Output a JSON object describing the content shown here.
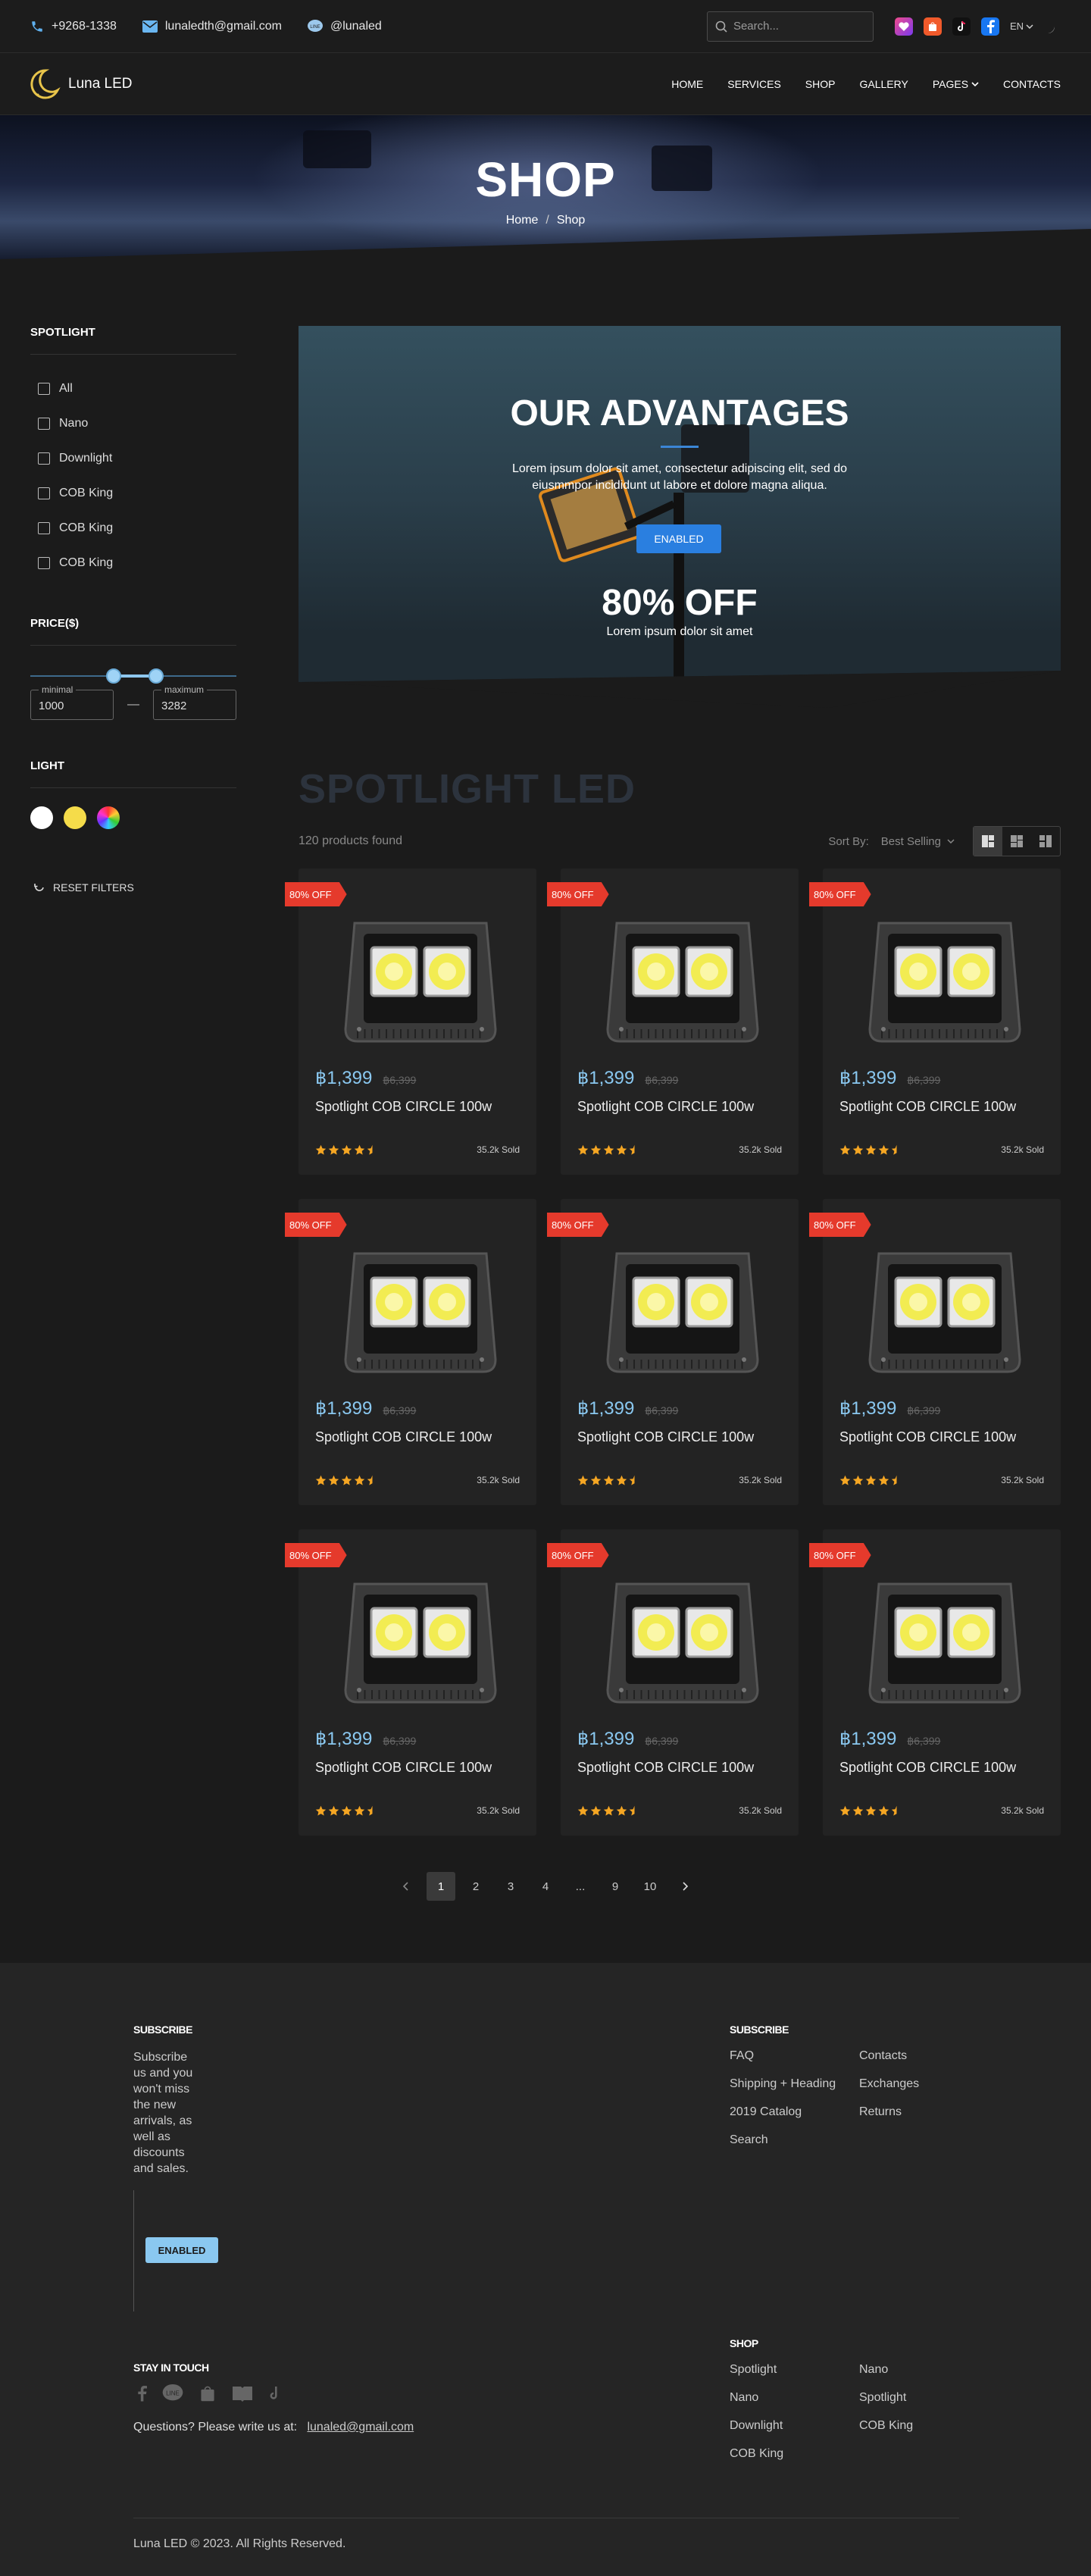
{
  "topbar": {
    "phone": "+9268-1338",
    "email": "lunaledth@gmail.com",
    "line_id": "@lunaled",
    "search_placeholder": "Search...",
    "lang": "EN"
  },
  "brand": {
    "name": "Luna LED",
    "accent": "#2a7fe0",
    "price_color": "#8ac8f0",
    "tag_color": "#e53a2c"
  },
  "nav": {
    "items": [
      "HOME",
      "SERVICES",
      "SHOP",
      "GALLERY",
      "PAGES",
      "CONTACTS"
    ]
  },
  "hero": {
    "title": "SHOP",
    "crumbs": [
      "Home",
      "Shop"
    ]
  },
  "sidebar": {
    "spotlight_title": "SPOTLIGHT",
    "categories": [
      "All",
      "Nano",
      "Downlight",
      "COB King",
      "COB King",
      "COB King"
    ],
    "price_title": "PRICE($)",
    "min_label": "minimal",
    "min_value": "1000",
    "max_label": "maximum",
    "max_value": "3282",
    "light_title": "LIGHT",
    "light_colors": [
      "#ffffff",
      "#f5dc4a",
      "multicolor"
    ],
    "reset": "RESET FILTERS"
  },
  "banner": {
    "title": "OUR ADVANTAGES",
    "desc": "Lorem ipsum dolor sit amet, consectetur adipiscing elit, sed do eiusmmpor incididunt ut labore et dolore magna aliqua.",
    "button": "ENABLED",
    "off": "80% OFF",
    "offsub": "Lorem ipsum dolor sit amet"
  },
  "listing": {
    "heading": "SPOTLIGHT LED",
    "found": "120 products found",
    "sort_label": "Sort By:",
    "sort_value": "Best Selling"
  },
  "products": [
    {
      "tag": "80% OFF",
      "price": "฿1,399",
      "old": "฿6,399",
      "title": "Spotlight COB CIRCLE 100w",
      "rating": 4.5,
      "sold": "35.2k Sold"
    },
    {
      "tag": "80% OFF",
      "price": "฿1,399",
      "old": "฿6,399",
      "title": "Spotlight COB CIRCLE 100w",
      "rating": 4.5,
      "sold": "35.2k Sold"
    },
    {
      "tag": "80% OFF",
      "price": "฿1,399",
      "old": "฿6,399",
      "title": "Spotlight COB CIRCLE 100w",
      "rating": 4.5,
      "sold": "35.2k Sold"
    },
    {
      "tag": "80% OFF",
      "price": "฿1,399",
      "old": "฿6,399",
      "title": "Spotlight COB CIRCLE 100w",
      "rating": 4.5,
      "sold": "35.2k Sold"
    },
    {
      "tag": "80% OFF",
      "price": "฿1,399",
      "old": "฿6,399",
      "title": "Spotlight COB CIRCLE 100w",
      "rating": 4.5,
      "sold": "35.2k Sold"
    },
    {
      "tag": "80% OFF",
      "price": "฿1,399",
      "old": "฿6,399",
      "title": "Spotlight COB CIRCLE 100w",
      "rating": 4.5,
      "sold": "35.2k Sold"
    },
    {
      "tag": "80% OFF",
      "price": "฿1,399",
      "old": "฿6,399",
      "title": "Spotlight COB CIRCLE 100w",
      "rating": 4.5,
      "sold": "35.2k Sold"
    },
    {
      "tag": "80% OFF",
      "price": "฿1,399",
      "old": "฿6,399",
      "title": "Spotlight COB CIRCLE 100w",
      "rating": 4.5,
      "sold": "35.2k Sold"
    },
    {
      "tag": "80% OFF",
      "price": "฿1,399",
      "old": "฿6,399",
      "title": "Spotlight COB CIRCLE 100w",
      "rating": 4.5,
      "sold": "35.2k Sold"
    }
  ],
  "pagination": {
    "pages": [
      "1",
      "2",
      "3",
      "4",
      "...",
      "9",
      "10"
    ],
    "current": "1"
  },
  "footer": {
    "subscribe_title": "SUBSCRIBE",
    "subscribe_text": "Subscribe us and you won't miss the new arrivals, as well as discounts and sales.",
    "subscribe_button": "ENABLED",
    "links_title": "SUBSCRIBE",
    "links": [
      "FAQ",
      "Contacts",
      "Shipping + Heading",
      "Exchanges",
      "2019 Catalog",
      "Returns",
      "Search"
    ],
    "stay_title": "STAY IN TOUCH",
    "social_icons": [
      "facebook-icon",
      "line-icon",
      "shop-icon",
      "book-icon",
      "tiktok-icon"
    ],
    "questions": "Questions? Please write us at:",
    "email": "lunaled@gmail.com",
    "shop_title": "SHOP",
    "shop_links": [
      "Spotlight",
      "Nano",
      "Nano",
      "Spotlight",
      "Downlight",
      "COB King",
      "COB King"
    ],
    "copyright": "Luna LED © 2023. All Rights Reserved."
  }
}
